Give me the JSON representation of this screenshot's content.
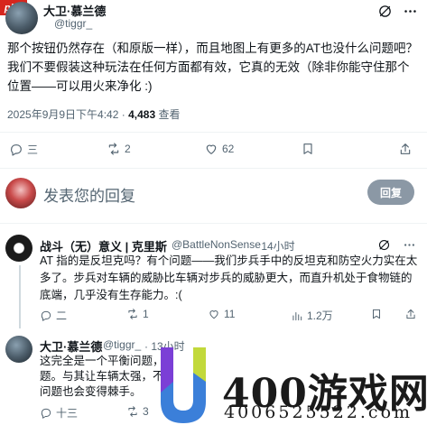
{
  "watermark_tl": "php",
  "main_tweet": {
    "name": "大卫·慕兰德",
    "handle": "@tiggr_",
    "text": "那个按钮仍然存在（和原版一样），而且地图上有更多的AT也没什么问题吧？我们不要假装这种玩法在任何方面都有效，它真的无效（除非你能守住那个位置——可以用火来净化 :)",
    "timestamp": "2025年9月9日下午4:42",
    "views_count": "4,483",
    "views_label": "查看",
    "replies": "三",
    "retweets": "2",
    "likes": "62"
  },
  "compose": {
    "placeholder": "发表您的回复",
    "button": "回复"
  },
  "reply1": {
    "name": "战斗（无）意义 | 克里斯",
    "handle": "@BattleNonSense",
    "time": "· 14小时",
    "text": "AT 指的是反坦克吗？有个问题——我们步兵手中的反坦克和防空火力实在太多了。步兵对车辆的威胁比车辆对步兵的威胁更大，而直升机处于食物链的底端，几乎没有生存能力。:(",
    "replies": "二",
    "retweets": "1",
    "likes": "11",
    "views": "1.2万"
  },
  "reply2": {
    "name": "大卫·慕兰德",
    "handle": "@tiggr_",
    "time": "· 13小时",
    "line1": "这完全是一个平衡问题，",
    "line2": "题。与其让车辆太强，不",
    "line3": "问题也会变得棘手。",
    "replies": "十三",
    "retweets": "3"
  },
  "watermark": {
    "brand": "400游戏网",
    "number": "4006525522.com"
  }
}
